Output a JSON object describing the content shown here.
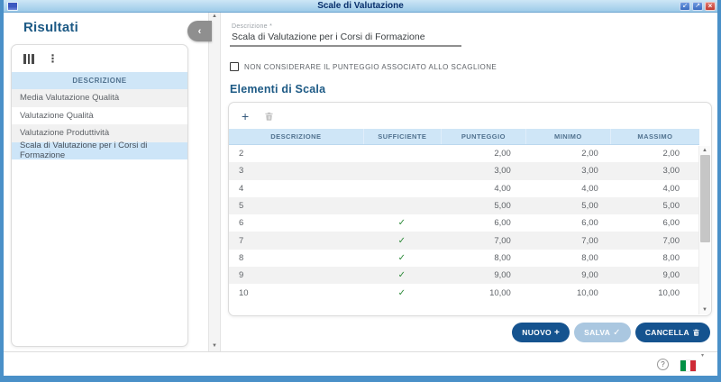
{
  "window": {
    "title": "Scale di Valutazione"
  },
  "icons": {
    "restore": "↙",
    "maximize": "↗",
    "close": "×",
    "kebab": "⋮",
    "collapse": "‹",
    "up_arrow": "▲",
    "down_arrow": "▼",
    "plus": "+",
    "check": "✓",
    "help": "?",
    "caret": "▾"
  },
  "colors": {
    "window_border": "#4a90c8",
    "titlebar": "#9ccae8",
    "heading_blue": "#1d5a85",
    "table_header_bg": "#cfe6f7",
    "selected_row_bg": "#cde5f8",
    "zebra_bg": "#f2f2f2",
    "check_green": "#2e8b3a",
    "button_blue": "#15538f",
    "button_disabled": "#aac7e0",
    "flag_green": "#009246",
    "flag_red": "#ce2b37"
  },
  "sidebar": {
    "title": "Risultati",
    "table": {
      "header": "DESCRIZIONE",
      "items": [
        {
          "label": "Media Valutazione Qualità",
          "selected": false
        },
        {
          "label": "Valutazione Qualità",
          "selected": false
        },
        {
          "label": "Valutazione Produttività",
          "selected": false
        },
        {
          "label": "Scala di Valutazione per i Corsi di Formazione",
          "selected": true
        }
      ]
    }
  },
  "main": {
    "description_field": {
      "label": "Descrizione *",
      "value": "Scala di Valutazione per i Corsi di Formazione"
    },
    "checkbox": {
      "label": "NON CONSIDERARE IL PUNTEGGIO ASSOCIATO ALLO SCAGLIONE",
      "checked": false
    },
    "section_title": "Elementi di Scala",
    "table": {
      "columns": [
        "DESCRIZIONE",
        "SUFFICIENTE",
        "PUNTEGGIO",
        "MINIMO",
        "MASSIMO"
      ],
      "rows": [
        {
          "descrizione": "2",
          "sufficiente": false,
          "punteggio": "2,00",
          "minimo": "2,00",
          "massimo": "2,00"
        },
        {
          "descrizione": "3",
          "sufficiente": false,
          "punteggio": "3,00",
          "minimo": "3,00",
          "massimo": "3,00"
        },
        {
          "descrizione": "4",
          "sufficiente": false,
          "punteggio": "4,00",
          "minimo": "4,00",
          "massimo": "4,00"
        },
        {
          "descrizione": "5",
          "sufficiente": false,
          "punteggio": "5,00",
          "minimo": "5,00",
          "massimo": "5,00"
        },
        {
          "descrizione": "6",
          "sufficiente": true,
          "punteggio": "6,00",
          "minimo": "6,00",
          "massimo": "6,00"
        },
        {
          "descrizione": "7",
          "sufficiente": true,
          "punteggio": "7,00",
          "minimo": "7,00",
          "massimo": "7,00"
        },
        {
          "descrizione": "8",
          "sufficiente": true,
          "punteggio": "8,00",
          "minimo": "8,00",
          "massimo": "8,00"
        },
        {
          "descrizione": "9",
          "sufficiente": true,
          "punteggio": "9,00",
          "minimo": "9,00",
          "massimo": "9,00"
        },
        {
          "descrizione": "10",
          "sufficiente": true,
          "punteggio": "10,00",
          "minimo": "10,00",
          "massimo": "10,00"
        }
      ]
    },
    "buttons": [
      {
        "label": "NUOVO",
        "icon_glyph": "+",
        "disabled": false
      },
      {
        "label": "SALVA",
        "icon_glyph": "✓",
        "disabled": true
      },
      {
        "label": "CANCELLA",
        "icon": "trash-icon",
        "disabled": false
      }
    ]
  },
  "footer": {
    "language": "italiano"
  }
}
